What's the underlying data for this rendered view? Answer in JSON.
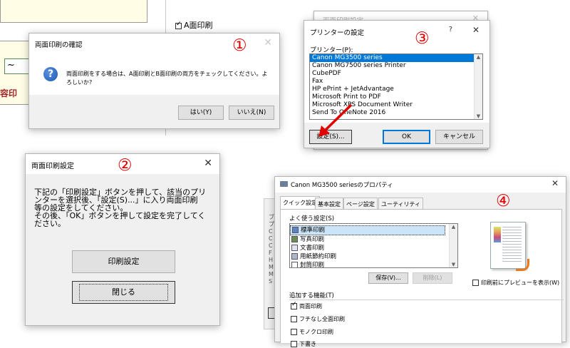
{
  "background": {
    "checkbox_a_label": "A面印刷",
    "partial_text_1": "~",
    "partial_text_2": "容印"
  },
  "colors": {
    "accent": "#0078d7",
    "annotation_red": "#e00000"
  },
  "dialog1": {
    "number": "①",
    "title": "両面印刷の確認",
    "icon": "question-icon",
    "message": "両面印刷をする場合は、A面印刷とB面印刷の両方をチェックしてください。よろしいか?",
    "yes_label": "はい(Y)",
    "no_label": "いいえ(N)"
  },
  "dialog2": {
    "number": "②",
    "title": "両面印刷設定",
    "instructions": [
      "下記の「印刷設定」ボタンを押して、該当のプリ",
      "ンターを選択後、「設定(S)...」に入り両面印刷",
      "等の設定をしてください。",
      "その後、「OK」ボタンを押して設定を完了してく",
      "ださい。"
    ],
    "print_settings_label": "印刷設定",
    "close_label": "閉じる"
  },
  "dialog3": {
    "number": "③",
    "behind_title": "両面印刷設定",
    "title": "プリンターの設定",
    "help": "?",
    "printer_label": "プリンター(P):",
    "printers": [
      "Canon MG3500 series",
      "Canon MG7500 series Printer",
      "CubePDF",
      "Fax",
      "HP ePrint + JetAdvantage",
      "Microsoft Print to PDF",
      "Microsoft XPS Document Writer",
      "Send To OneNote 2016"
    ],
    "selected_index": 0,
    "settings_label": "設定(S)...",
    "ok_label": "OK",
    "cancel_label": "キャンセル"
  },
  "dialog4": {
    "number": "④",
    "title": "Canon MG3500 seriesのプロパティ",
    "tabs": [
      "クイック設定",
      "基本設定",
      "ページ設定",
      "ユーティリティ"
    ],
    "active_tab": 0,
    "frequent_label": "よく使う設定(S)",
    "presets": [
      {
        "label": "標準印刷",
        "selected": true
      },
      {
        "label": "写真印刷",
        "selected": false
      },
      {
        "label": "文書印刷",
        "selected": false
      },
      {
        "label": "用紙節約印刷",
        "selected": false
      },
      {
        "label": "封筒印刷",
        "selected": false
      }
    ],
    "save_label": "保存(V)...",
    "delete_label": "削除(L)",
    "preview_label": "印刷前にプレビューを表示(W)",
    "additional_label": "追加する機能(T)",
    "features": [
      {
        "label": "両面印刷",
        "checked": true
      },
      {
        "label": "フチなし全面印刷",
        "checked": false
      },
      {
        "label": "モノクロ印刷",
        "checked": false
      },
      {
        "label": "下書き",
        "checked": false
      }
    ]
  }
}
